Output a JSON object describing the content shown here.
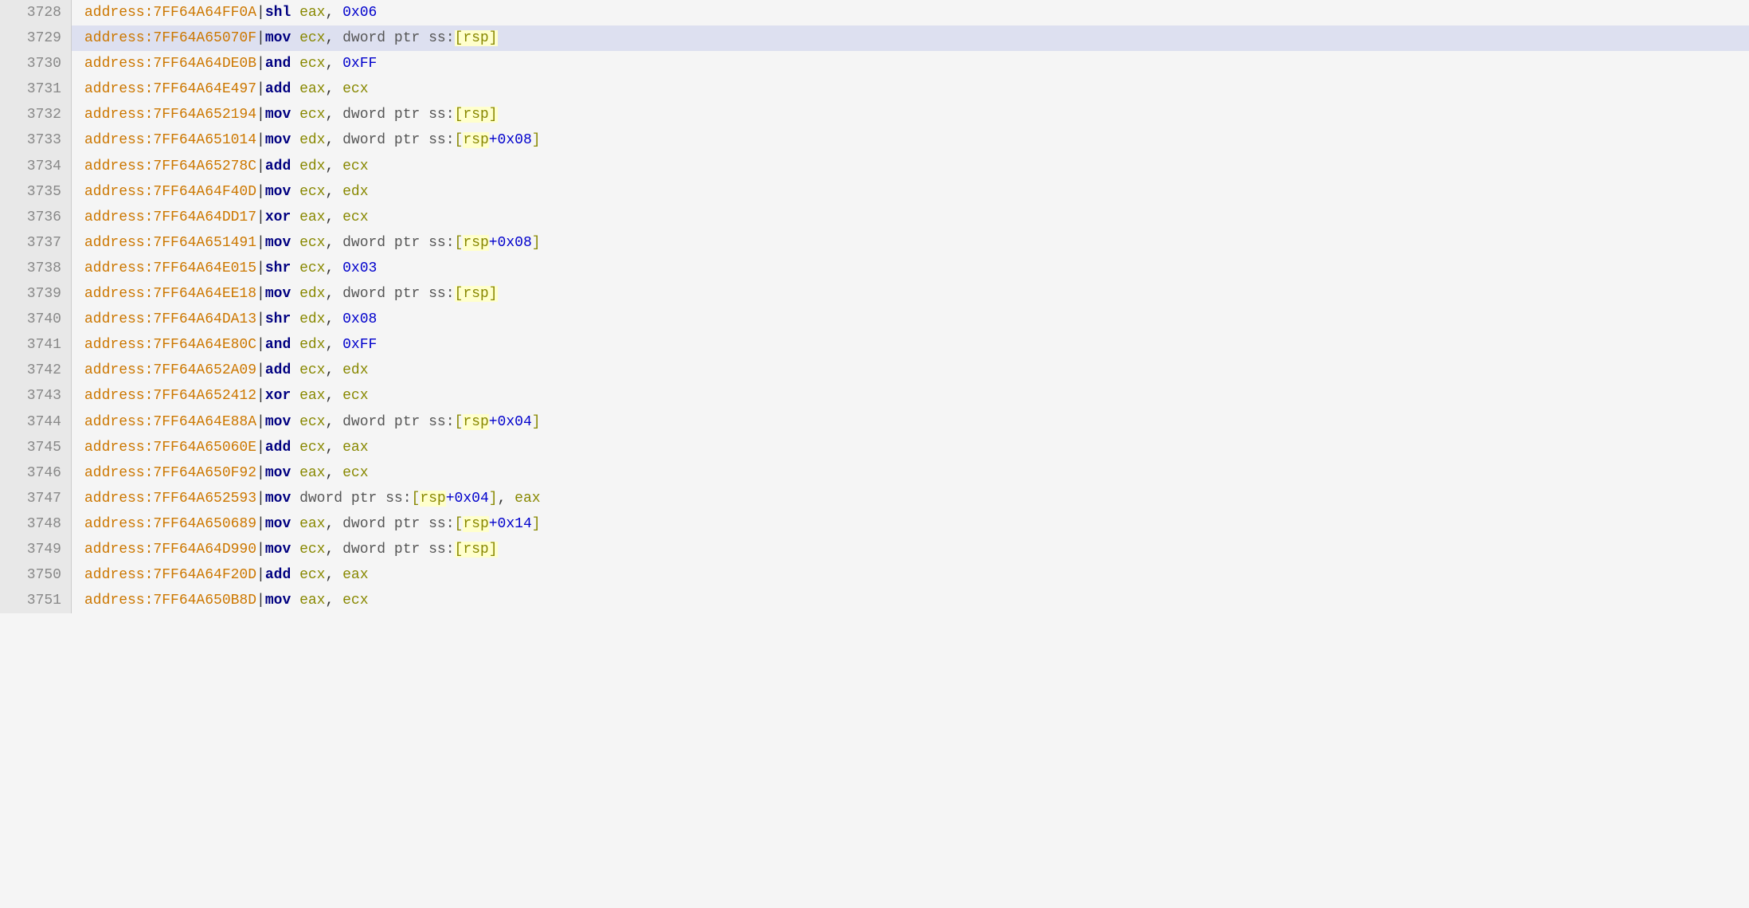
{
  "rows": [
    {
      "num": "3728",
      "highlight": false,
      "addr": "7FF64A64FF0A",
      "mnem": "shl",
      "ops": [
        {
          "type": "reg",
          "val": "eax"
        },
        {
          "type": "comma",
          "val": ", "
        },
        {
          "type": "imm",
          "val": "0x06"
        }
      ]
    },
    {
      "num": "3729",
      "highlight": true,
      "addr": "7FF64A65070F",
      "mnem": "mov",
      "ops": [
        {
          "type": "reg",
          "val": "ecx"
        },
        {
          "type": "comma",
          "val": ", "
        },
        {
          "type": "kw",
          "val": "dword"
        },
        {
          "type": "kw",
          "val": " ptr "
        },
        {
          "type": "seg",
          "val": "ss:"
        },
        {
          "type": "membracket",
          "val": "[rsp]"
        }
      ]
    },
    {
      "num": "3730",
      "highlight": false,
      "addr": "7FF64A64DE0B",
      "mnem": "and",
      "ops": [
        {
          "type": "reg",
          "val": "ecx"
        },
        {
          "type": "comma",
          "val": ", "
        },
        {
          "type": "imm",
          "val": "0xFF"
        }
      ]
    },
    {
      "num": "3731",
      "highlight": false,
      "addr": "7FF64A64E497",
      "mnem": "add",
      "ops": [
        {
          "type": "reg",
          "val": "eax"
        },
        {
          "type": "comma",
          "val": ", "
        },
        {
          "type": "reg",
          "val": "ecx"
        }
      ]
    },
    {
      "num": "3732",
      "highlight": false,
      "addr": "7FF64A652194",
      "mnem": "mov",
      "ops": [
        {
          "type": "reg",
          "val": "ecx"
        },
        {
          "type": "comma",
          "val": ", "
        },
        {
          "type": "kw",
          "val": "dword"
        },
        {
          "type": "kw",
          "val": " ptr "
        },
        {
          "type": "seg",
          "val": "ss:"
        },
        {
          "type": "membracket",
          "val": "[rsp]"
        }
      ]
    },
    {
      "num": "3733",
      "highlight": false,
      "addr": "7FF64A651014",
      "mnem": "mov",
      "ops": [
        {
          "type": "reg",
          "val": "edx"
        },
        {
          "type": "comma",
          "val": ", "
        },
        {
          "type": "kw",
          "val": "dword"
        },
        {
          "type": "kw",
          "val": " ptr "
        },
        {
          "type": "seg",
          "val": "ss:"
        },
        {
          "type": "membracket_offset",
          "val": "[rsp",
          "offset": "+0x08",
          "close": "]"
        }
      ]
    },
    {
      "num": "3734",
      "highlight": false,
      "addr": "7FF64A65278C",
      "mnem": "add",
      "ops": [
        {
          "type": "reg",
          "val": "edx"
        },
        {
          "type": "comma",
          "val": ", "
        },
        {
          "type": "reg",
          "val": "ecx"
        }
      ]
    },
    {
      "num": "3735",
      "highlight": false,
      "addr": "7FF64A64F40D",
      "mnem": "mov",
      "ops": [
        {
          "type": "reg",
          "val": "ecx"
        },
        {
          "type": "comma",
          "val": ", "
        },
        {
          "type": "reg",
          "val": "edx"
        }
      ]
    },
    {
      "num": "3736",
      "highlight": false,
      "addr": "7FF64A64DD17",
      "mnem": "xor",
      "ops": [
        {
          "type": "reg",
          "val": "eax"
        },
        {
          "type": "comma",
          "val": ", "
        },
        {
          "type": "reg",
          "val": "ecx"
        }
      ]
    },
    {
      "num": "3737",
      "highlight": false,
      "addr": "7FF64A651491",
      "mnem": "mov",
      "ops": [
        {
          "type": "reg",
          "val": "ecx"
        },
        {
          "type": "comma",
          "val": ", "
        },
        {
          "type": "kw",
          "val": "dword"
        },
        {
          "type": "kw",
          "val": " ptr "
        },
        {
          "type": "seg",
          "val": "ss:"
        },
        {
          "type": "membracket_offset",
          "val": "[rsp",
          "offset": "+0x08",
          "close": "]"
        }
      ]
    },
    {
      "num": "3738",
      "highlight": false,
      "addr": "7FF64A64E015",
      "mnem": "shr",
      "ops": [
        {
          "type": "reg",
          "val": "ecx"
        },
        {
          "type": "comma",
          "val": ", "
        },
        {
          "type": "imm",
          "val": "0x03"
        }
      ]
    },
    {
      "num": "3739",
      "highlight": false,
      "addr": "7FF64A64EE18",
      "mnem": "mov",
      "ops": [
        {
          "type": "reg",
          "val": "edx"
        },
        {
          "type": "comma",
          "val": ", "
        },
        {
          "type": "kw",
          "val": "dword"
        },
        {
          "type": "kw",
          "val": " ptr "
        },
        {
          "type": "seg",
          "val": "ss:"
        },
        {
          "type": "membracket",
          "val": "[rsp]"
        }
      ]
    },
    {
      "num": "3740",
      "highlight": false,
      "addr": "7FF64A64DA13",
      "mnem": "shr",
      "ops": [
        {
          "type": "reg",
          "val": "edx"
        },
        {
          "type": "comma",
          "val": ", "
        },
        {
          "type": "imm",
          "val": "0x08"
        }
      ]
    },
    {
      "num": "3741",
      "highlight": false,
      "addr": "7FF64A64E80C",
      "mnem": "and",
      "ops": [
        {
          "type": "reg",
          "val": "edx"
        },
        {
          "type": "comma",
          "val": ", "
        },
        {
          "type": "imm",
          "val": "0xFF"
        }
      ]
    },
    {
      "num": "3742",
      "highlight": false,
      "addr": "7FF64A652A09",
      "mnem": "add",
      "ops": [
        {
          "type": "reg",
          "val": "ecx"
        },
        {
          "type": "comma",
          "val": ", "
        },
        {
          "type": "reg",
          "val": "edx"
        }
      ]
    },
    {
      "num": "3743",
      "highlight": false,
      "addr": "7FF64A652412",
      "mnem": "xor",
      "ops": [
        {
          "type": "reg",
          "val": "eax"
        },
        {
          "type": "comma",
          "val": ", "
        },
        {
          "type": "reg",
          "val": "ecx"
        }
      ]
    },
    {
      "num": "3744",
      "highlight": false,
      "addr": "7FF64A64E88A",
      "mnem": "mov",
      "ops": [
        {
          "type": "reg",
          "val": "ecx"
        },
        {
          "type": "comma",
          "val": ", "
        },
        {
          "type": "kw",
          "val": "dword"
        },
        {
          "type": "kw",
          "val": " ptr "
        },
        {
          "type": "seg",
          "val": "ss:"
        },
        {
          "type": "membracket_offset",
          "val": "[rsp",
          "offset": "+0x04",
          "close": "]"
        }
      ]
    },
    {
      "num": "3745",
      "highlight": false,
      "addr": "7FF64A65060E",
      "mnem": "add",
      "ops": [
        {
          "type": "reg",
          "val": "ecx"
        },
        {
          "type": "comma",
          "val": ", "
        },
        {
          "type": "reg",
          "val": "eax"
        }
      ]
    },
    {
      "num": "3746",
      "highlight": false,
      "addr": "7FF64A650F92",
      "mnem": "mov",
      "ops": [
        {
          "type": "reg",
          "val": "eax"
        },
        {
          "type": "comma",
          "val": ", "
        },
        {
          "type": "reg",
          "val": "ecx"
        }
      ]
    },
    {
      "num": "3747",
      "highlight": false,
      "addr": "7FF64A652593",
      "mnem": "mov",
      "ops": [
        {
          "type": "kw",
          "val": "dword"
        },
        {
          "type": "kw",
          "val": " ptr "
        },
        {
          "type": "seg",
          "val": "ss:"
        },
        {
          "type": "membracket_offset",
          "val": "[rsp",
          "offset": "+0x04",
          "close": "]"
        },
        {
          "type": "comma",
          "val": ", "
        },
        {
          "type": "reg",
          "val": "eax"
        }
      ]
    },
    {
      "num": "3748",
      "highlight": false,
      "addr": "7FF64A650689",
      "mnem": "mov",
      "ops": [
        {
          "type": "reg",
          "val": "eax"
        },
        {
          "type": "comma",
          "val": ", "
        },
        {
          "type": "kw",
          "val": "dword"
        },
        {
          "type": "kw",
          "val": " ptr "
        },
        {
          "type": "seg",
          "val": "ss:"
        },
        {
          "type": "membracket_offset",
          "val": "[rsp",
          "offset": "+0x14",
          "close": "]"
        }
      ]
    },
    {
      "num": "3749",
      "highlight": false,
      "addr": "7FF64A64D990",
      "mnem": "mov",
      "ops": [
        {
          "type": "reg",
          "val": "ecx"
        },
        {
          "type": "comma",
          "val": ", "
        },
        {
          "type": "kw",
          "val": "dword"
        },
        {
          "type": "kw",
          "val": " ptr "
        },
        {
          "type": "seg",
          "val": "ss:"
        },
        {
          "type": "membracket",
          "val": "[rsp]"
        }
      ]
    },
    {
      "num": "3750",
      "highlight": false,
      "addr": "7FF64A64F20D",
      "mnem": "add",
      "ops": [
        {
          "type": "reg",
          "val": "ecx"
        },
        {
          "type": "comma",
          "val": ", "
        },
        {
          "type": "reg",
          "val": "eax"
        }
      ]
    },
    {
      "num": "3751",
      "highlight": false,
      "addr": "7FF64A650B8D",
      "mnem": "mov",
      "ops": [
        {
          "type": "reg",
          "val": "eax"
        },
        {
          "type": "comma",
          "val": ", "
        },
        {
          "type": "reg",
          "val": "ecx"
        }
      ]
    }
  ]
}
